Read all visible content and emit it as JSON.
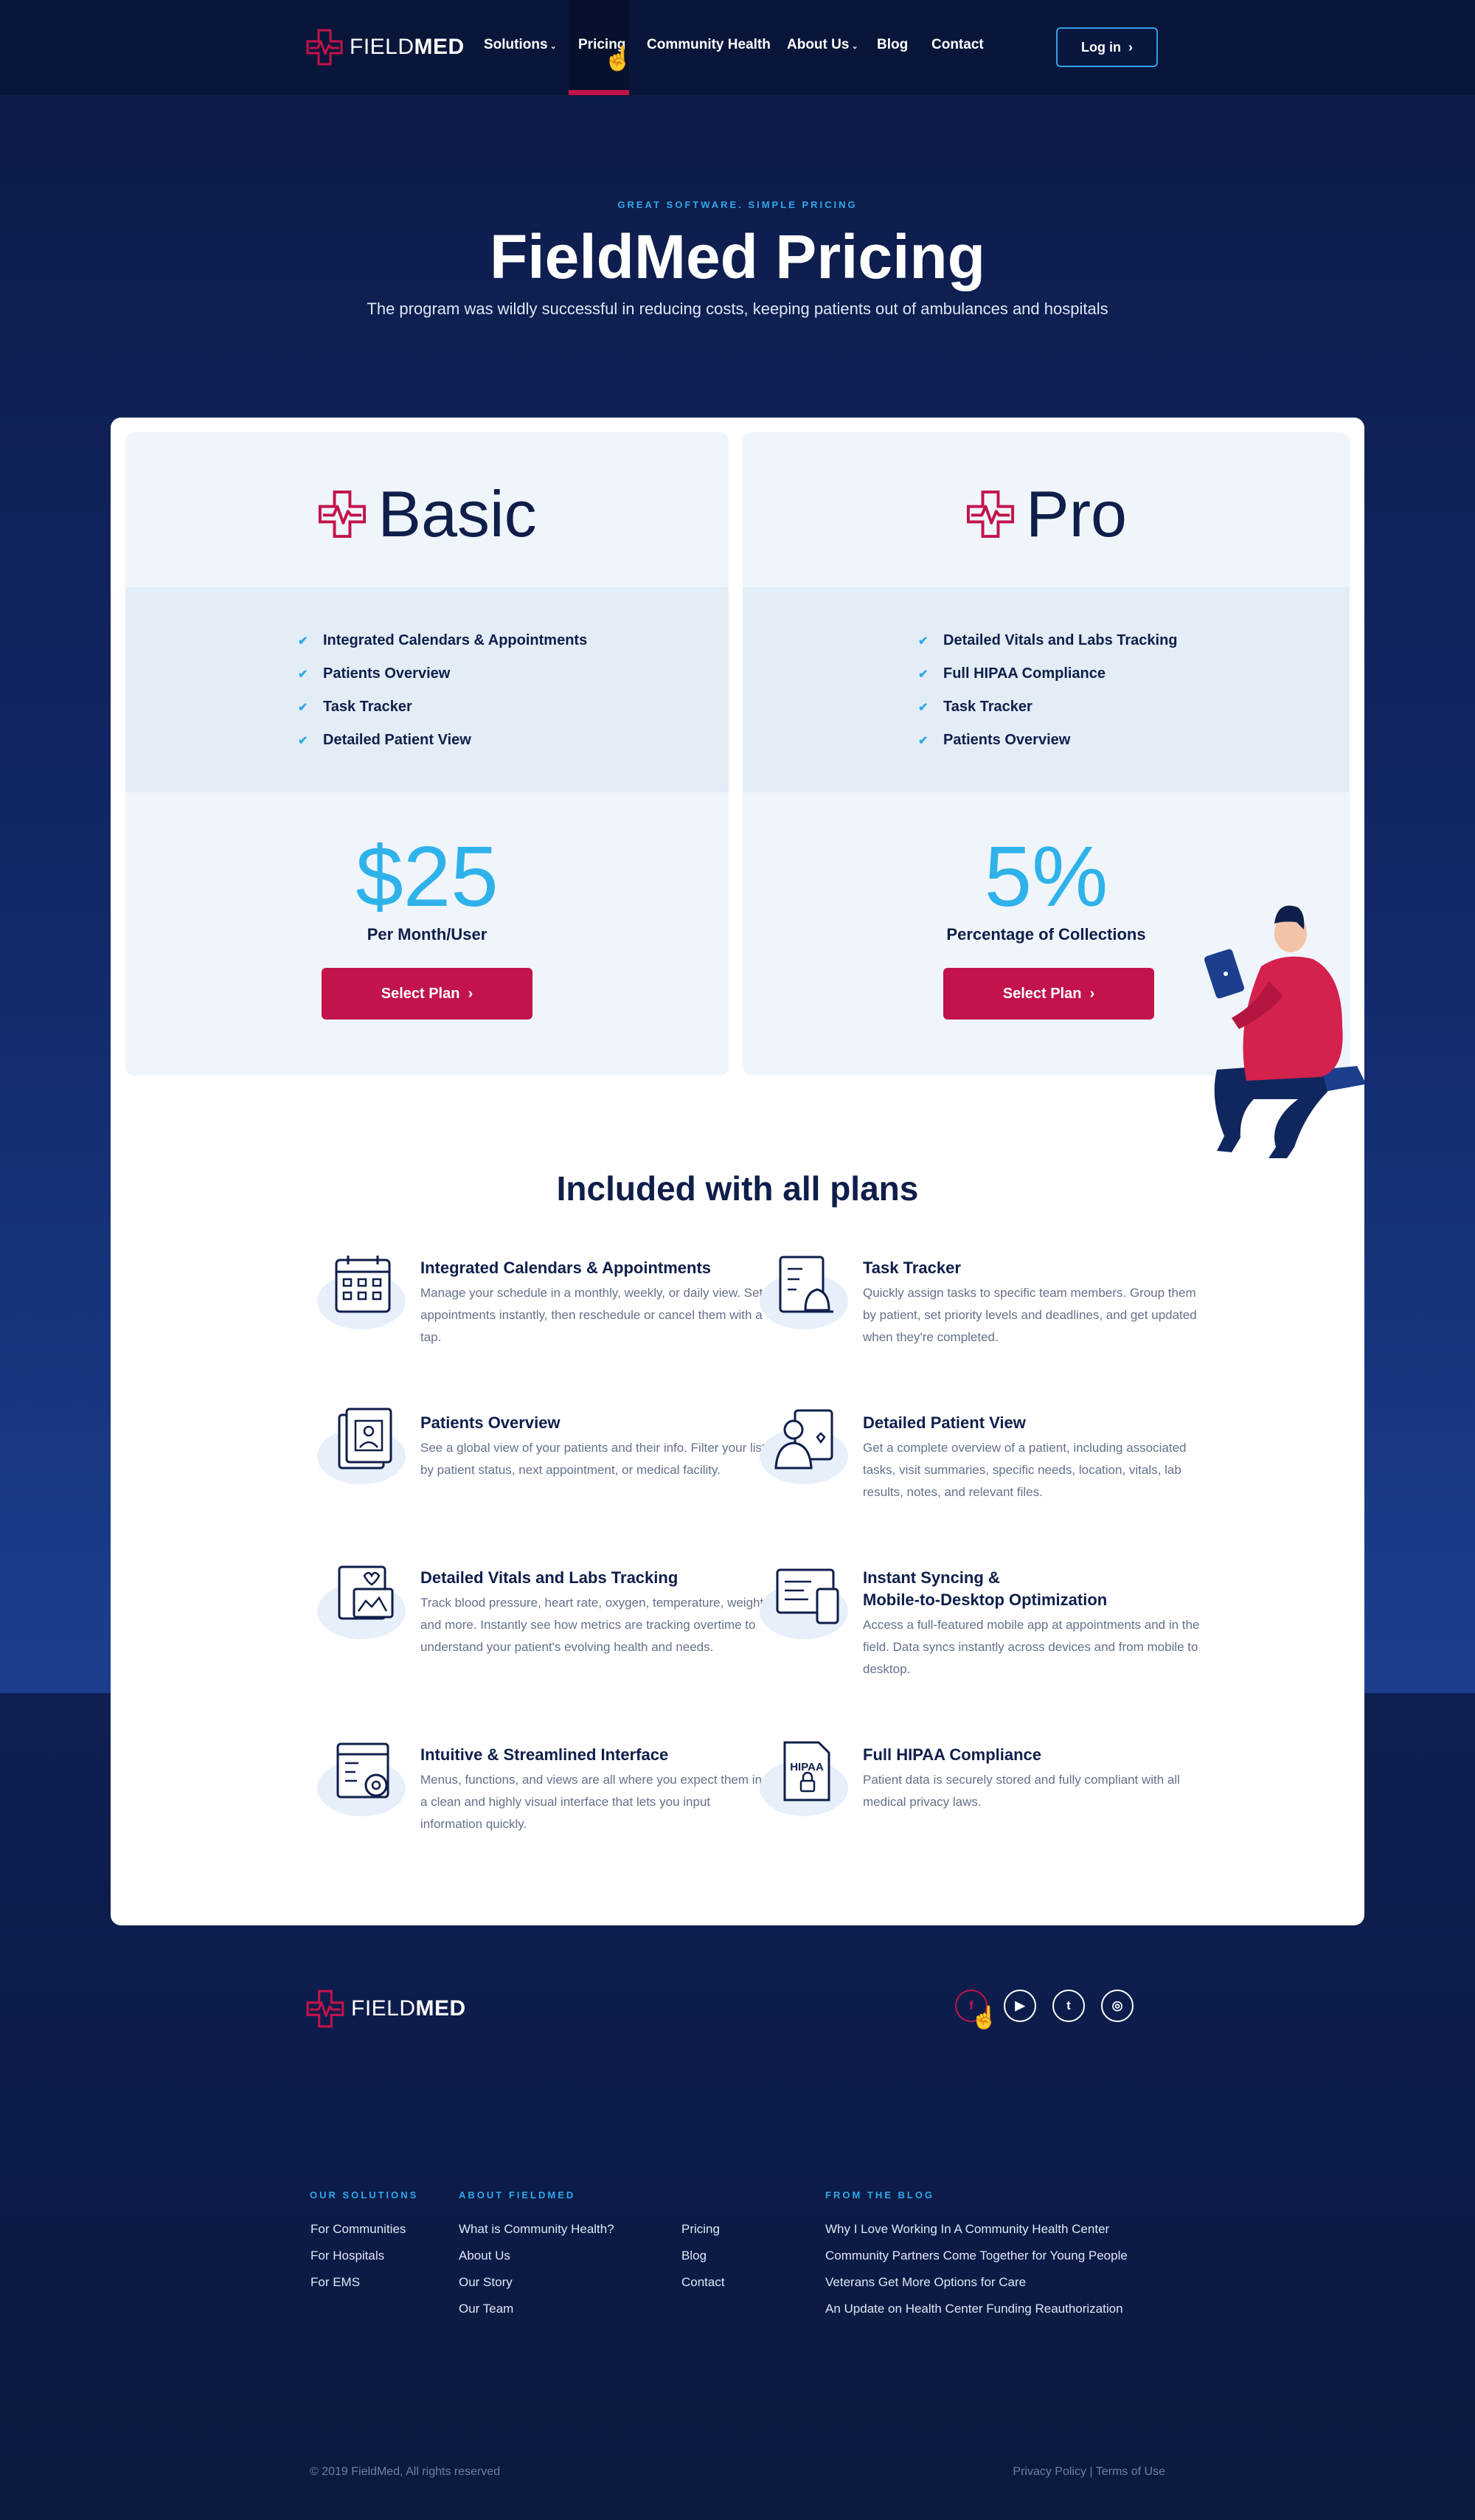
{
  "brand": {
    "name_light": "FIELD",
    "name_bold": "MED"
  },
  "nav": {
    "items": [
      {
        "label": "Solutions",
        "has_dropdown": true
      },
      {
        "label": "Pricing",
        "active": true
      },
      {
        "label": "Community Health"
      },
      {
        "label": "About Us",
        "has_dropdown": true
      },
      {
        "label": "Blog"
      },
      {
        "label": "Contact"
      }
    ],
    "login_label": "Log in"
  },
  "hero": {
    "eyebrow": "GREAT SOFTWARE. SIMPLE PRICING",
    "title": "FieldMed Pricing",
    "subtitle": "The program was wildly successful in reducing costs, keeping patients out of ambulances and hospitals"
  },
  "plans": [
    {
      "name": "Basic",
      "features": [
        "Integrated Calendars & Appointments",
        "Patients Overview",
        "Task Tracker",
        "Detailed Patient View"
      ],
      "price": "$25",
      "price_label": "Per Month/User",
      "button": "Select Plan"
    },
    {
      "name": "Pro",
      "features": [
        "Detailed Vitals and Labs Tracking",
        "Full HIPAA Compliance",
        "Task Tracker",
        "Patients Overview"
      ],
      "price": "5%",
      "price_label": "Percentage of Collections",
      "button": "Select Plan"
    }
  ],
  "included": {
    "title": "Included with all plans",
    "items": [
      {
        "title": "Integrated Calendars & Appointments",
        "desc": "Manage your schedule in a monthly, weekly, or daily view. Set appointments instantly, then reschedule or cancel them with a tap.",
        "icon": "calendar-icon"
      },
      {
        "title": "Task Tracker",
        "desc": "Quickly assign tasks to specific team members. Group them by patient, set priority levels and deadlines, and get updated when they're completed.",
        "icon": "task-bell-icon"
      },
      {
        "title": "Patients Overview",
        "desc": "See a global view of your patients and their info. Filter your list by patient status, next appointment, or medical facility.",
        "icon": "patient-files-icon"
      },
      {
        "title": "Detailed Patient View",
        "desc": "Get a complete overview of a patient, including associated tasks, visit summaries, specific needs, location, vitals, lab results, notes, and relevant files.",
        "icon": "doctor-file-icon"
      },
      {
        "title": "Detailed Vitals and Labs Tracking",
        "desc": "Track blood pressure, heart rate, oxygen, temperature, weight, and more. Instantly see how metrics are tracking overtime to understand your patient's evolving health and needs.",
        "icon": "vitals-chart-icon"
      },
      {
        "title_line1": "Instant Syncing &",
        "title_line2": "Mobile-to-Desktop Optimization",
        "desc": "Access a full-featured mobile app at appointments and in the field. Data syncs instantly across devices and from mobile to desktop.",
        "icon": "devices-sync-icon"
      },
      {
        "title": "Intuitive & Streamlined Interface",
        "desc": "Menus, functions, and views are all where you expect them in a clean and highly visual interface that lets you input information quickly.",
        "icon": "settings-window-icon"
      },
      {
        "title": "Full HIPAA Compliance",
        "desc": "Patient data is securely stored and fully compliant with all medical privacy laws.",
        "icon": "hipaa-lock-icon",
        "icon_text": "HIPAA"
      }
    ]
  },
  "footer": {
    "socials": [
      "f",
      "▶",
      "t",
      "◎"
    ],
    "col_heads": {
      "solutions": "OUR SOLUTIONS",
      "about": "ABOUT FIELDMED",
      "blog": "FROM THE BLOG"
    },
    "solutions": [
      "For Communities",
      "For Hospitals",
      "For EMS"
    ],
    "about": [
      "What is Community Health?",
      "About Us",
      "Our Story",
      "Our Team"
    ],
    "about2": [
      "Pricing",
      "Blog",
      "Contact"
    ],
    "blog": [
      "Why I Love Working In A Community Health Center",
      "Community Partners Come Together for Young People",
      "Veterans Get More Options for Care",
      "An Update on Health Center Funding Reauthorization"
    ],
    "copyright": "© 2019 FieldMed, All rights reserved",
    "privacy": "Privacy Policy",
    "terms": "Terms of Use"
  },
  "colors": {
    "accent_red": "#c2134a",
    "accent_blue": "#2fa8ea",
    "navy": "#0f1e4a"
  }
}
